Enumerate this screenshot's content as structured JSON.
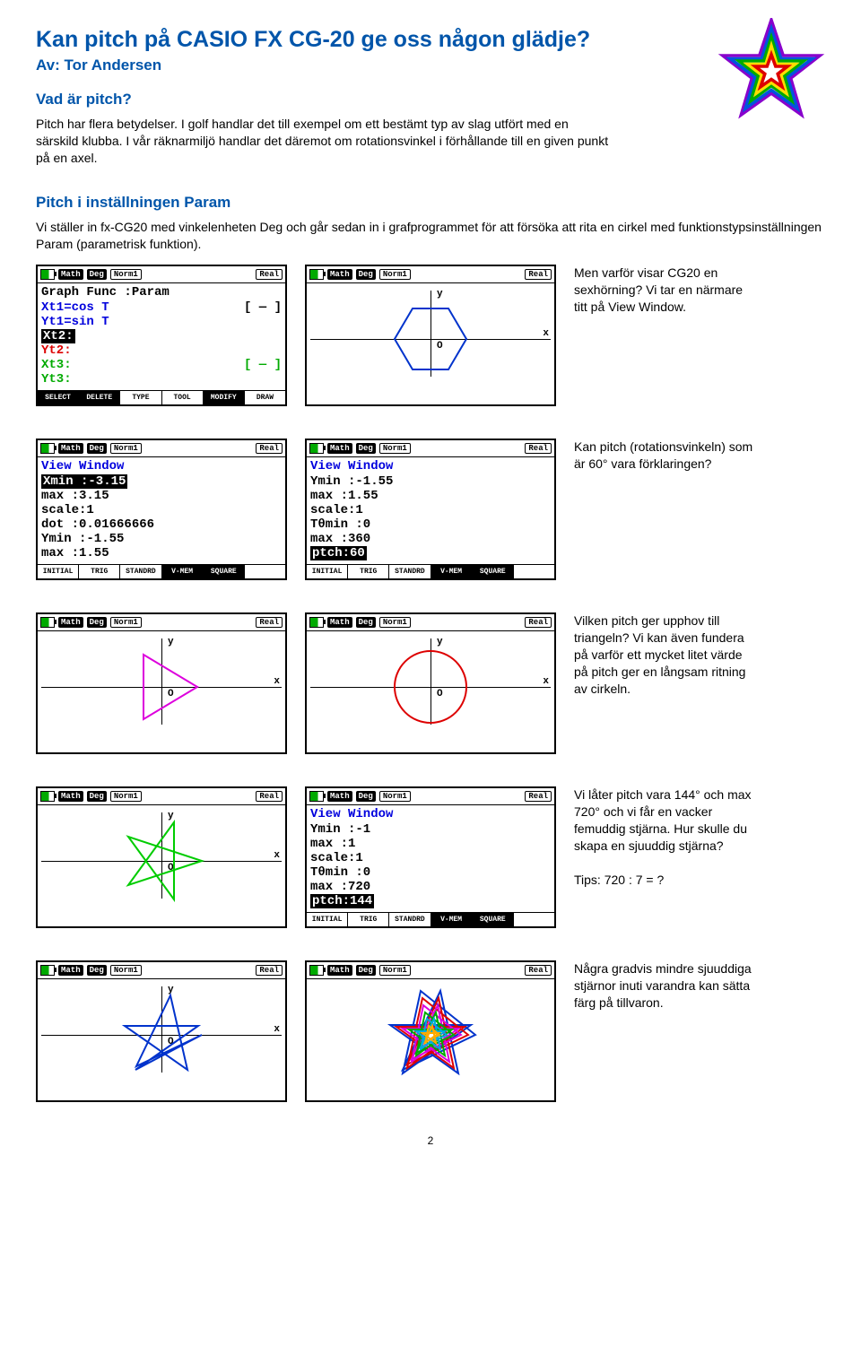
{
  "title": "Kan pitch på CASIO FX CG-20 ge oss någon glädje?",
  "author": "Av: Tor Andersen",
  "section1": {
    "heading": "Vad är pitch?",
    "body": "Pitch har flera betydelser. I golf handlar det till exempel om ett bestämt typ av slag utfört med en särskild klubba. I vår räknarmiljö handlar det däremot om rotationsvinkel i förhållande till en given punkt på en axel."
  },
  "section2": {
    "heading": "Pitch i inställningen Param",
    "body": "Vi ställer in fx-CG20 med vinkelenheten Deg och går sedan in i grafprogrammet för att försöka att rita en cirkel med funktionstypsinställningen Param (parametrisk funktion)."
  },
  "badges": {
    "math": "Math",
    "deg": "Deg",
    "norm": "Norm1",
    "real": "Real"
  },
  "row1": {
    "left": {
      "l1": "Graph Func  :Param",
      "xt1a": "Xt1",
      "xt1b": "=cos T",
      "xt1c": "[ — ]",
      "yt1a": "Yt1",
      "yt1b": "=sin T",
      "xt2": "Xt2:",
      "yt2": "Yt2:",
      "xt3": "Xt3:",
      "xt3c": "[ — ]",
      "yt3": "Yt3:",
      "fkeys": [
        "SELECT",
        "DELETE",
        "TYPE",
        "TOOL",
        "MODIFY",
        "DRAW"
      ]
    },
    "note": "Men varför visar CG20 en sexhörning? Vi tar en närmare titt på View Window."
  },
  "row2": {
    "left": {
      "title": "View Window",
      "l1": "Xmin  :-3.15",
      "l2": " max  :3.15",
      "l3": " scale:1",
      "l4": " dot  :0.01666666",
      "l5": "Ymin  :-1.55",
      "l6": " max  :1.55",
      "fkeys": [
        "INITIAL",
        "TRIG",
        "STANDRD",
        "V-MEM",
        "SQUARE",
        ""
      ]
    },
    "right": {
      "title": "View Window",
      "l1": "Ymin  :-1.55",
      "l2": " max  :1.55",
      "l3": " scale:1",
      "l4": "Tθmin :0",
      "l5": "  max :360",
      "l6": "  ptch:60",
      "fkeys": [
        "INITIAL",
        "TRIG",
        "STANDRD",
        "V-MEM",
        "SQUARE",
        ""
      ]
    },
    "note": "Kan pitch (rotationsvinkeln) som är 60° vara förklaringen?"
  },
  "row3": {
    "note": "Vilken pitch ger upphov till triangeln? Vi kan även fundera på varför ett mycket litet värde på pitch ger en långsam ritning av cirkeln."
  },
  "row4": {
    "right": {
      "title": "View Window",
      "l1": "Ymin  :-1",
      "l2": " max  :1",
      "l3": " scale:1",
      "l4": "Tθmin :0",
      "l5": "  max :720",
      "l6": "  ptch:144",
      "fkeys": [
        "INITIAL",
        "TRIG",
        "STANDRD",
        "V-MEM",
        "SQUARE",
        ""
      ]
    },
    "note": "Vi låter pitch vara 144° och max 720° och vi får en vacker femuddig stjärna. Hur skulle du skapa en sjuuddig stjärna?",
    "tip": "Tips: 720 : 7 = ?"
  },
  "row5": {
    "note": "Några gradvis mindre sjuuddiga stjärnor inuti varandra kan sätta färg på tillvaron."
  },
  "pagenum": "2"
}
